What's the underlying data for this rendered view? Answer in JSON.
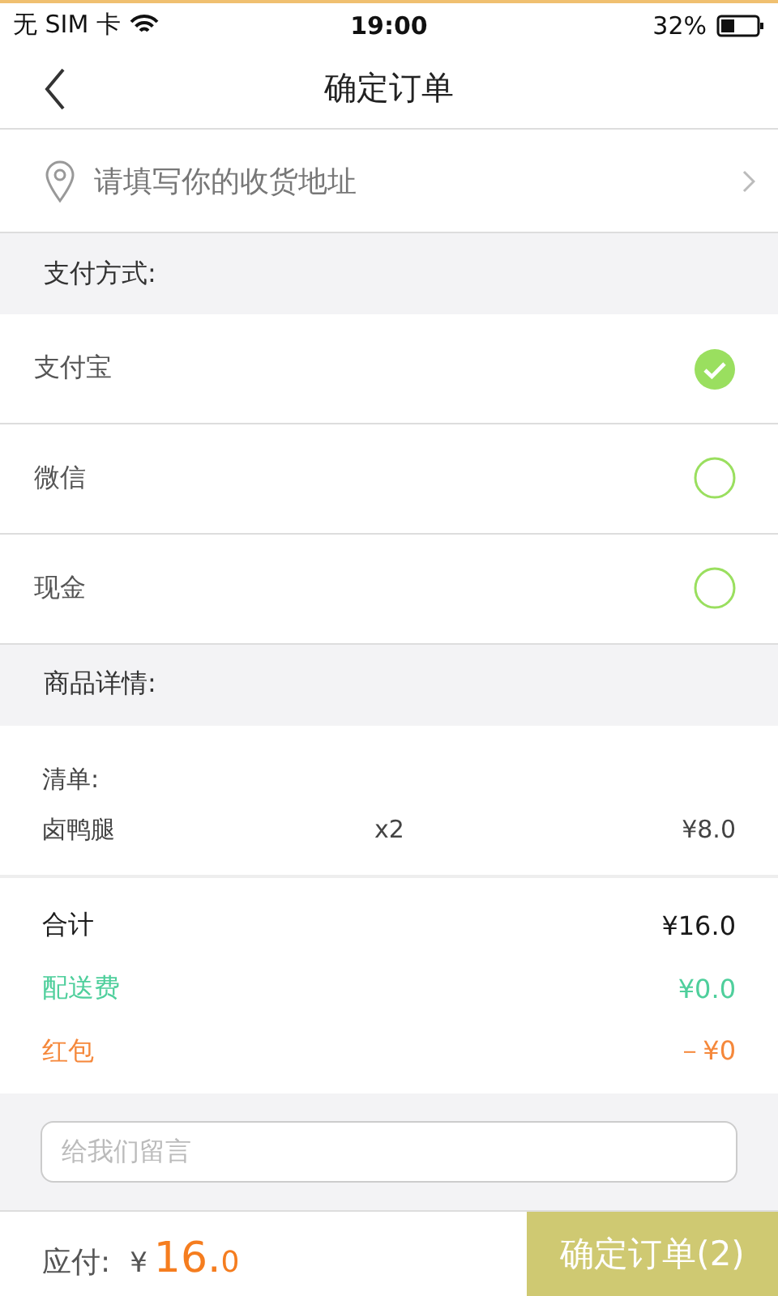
{
  "status_bar": {
    "carrier": "无 SIM 卡",
    "time": "19:00",
    "battery": "32%"
  },
  "header": {
    "title": "确定订单"
  },
  "address": {
    "placeholder": "请填写你的收货地址"
  },
  "payment": {
    "heading": "支付方式:",
    "methods": [
      {
        "label": "支付宝",
        "selected": true
      },
      {
        "label": "微信",
        "selected": false
      },
      {
        "label": "现金",
        "selected": false
      }
    ]
  },
  "details": {
    "heading": "商品详情:",
    "list_label": "清单:",
    "items": [
      {
        "name": "卤鸭腿",
        "quantity": "x2",
        "price": "¥8.0"
      }
    ]
  },
  "summary": [
    {
      "label": "合计",
      "value": "¥16.0",
      "color": "#1a1a1a"
    },
    {
      "label": "配送费",
      "value": "¥0.0",
      "color": "#4fcf9c"
    },
    {
      "label": "红包",
      "value": "－¥0",
      "color": "#f5883b"
    }
  ],
  "message": {
    "placeholder": "给我们留言"
  },
  "footer": {
    "label": "应付:",
    "currency": "¥",
    "amount_main": "16.",
    "amount_decimal": "0",
    "button": "确定订单(2)"
  }
}
